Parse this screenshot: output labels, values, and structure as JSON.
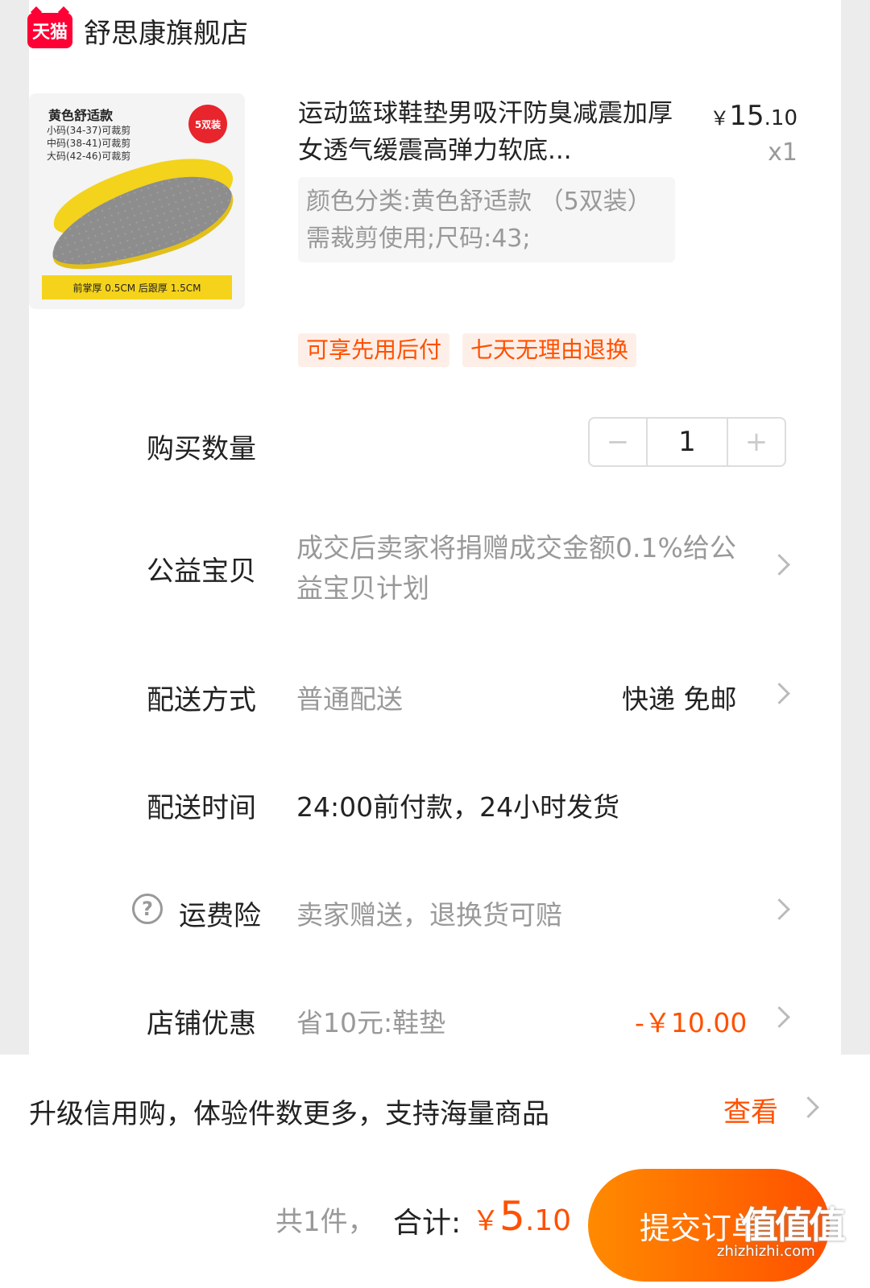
{
  "store": {
    "badge": "天猫",
    "name": "舒思康旗舰店"
  },
  "product": {
    "image": {
      "title": "黄色舒适款",
      "sizes": [
        "小码(34-37)可裁剪",
        "中码(38-41)可裁剪",
        "大码(42-46)可裁剪"
      ],
      "pack_badge": "5双装",
      "band_text": "前掌厚 0.5CM   后跟厚 1.5CM"
    },
    "title": "运动篮球鞋垫男吸汗防臭减震加厚女透气缓震高弹力软底...",
    "price_symbol": "￥",
    "price_int": "15",
    "price_dec": ".10",
    "quantity_label": "x1",
    "spec": "颜色分类:黄色舒适款 （5双装）需裁剪使用;尺码:43;",
    "tags": [
      "可享先用后付",
      "七天无理由退换"
    ]
  },
  "quantity": {
    "label": "购买数量",
    "value": "1",
    "minus": "−",
    "plus": "+"
  },
  "charity": {
    "label": "公益宝贝",
    "value": "成交后卖家将捐赠成交金额0.1%给公益宝贝计划"
  },
  "delivery": {
    "label": "配送方式",
    "value": "普通配送",
    "extra": "快递 免邮"
  },
  "delivery_time": {
    "label": "配送时间",
    "value": "24:00前付款，24小时发货"
  },
  "shipping_insurance": {
    "label": "运费险",
    "value": "卖家赠送，退换货可赔"
  },
  "shop_discount": {
    "label": "店铺优惠",
    "value": "省10元:鞋垫",
    "amount": "-￥10.00"
  },
  "credit": {
    "text": "升级信用购，体验件数更多，支持海量商品",
    "link": "查看"
  },
  "footer": {
    "count": "共1件，",
    "total_label": "合计:",
    "total_symbol": "￥",
    "total_int": "5",
    "total_dec": ".10",
    "submit": "提交订单"
  },
  "watermark": {
    "logo": "值值值",
    "url": "zhizhizhi.com"
  },
  "colors": {
    "accent": "#ff5000",
    "tmall_red": "#ff0036",
    "muted": "#999999"
  }
}
